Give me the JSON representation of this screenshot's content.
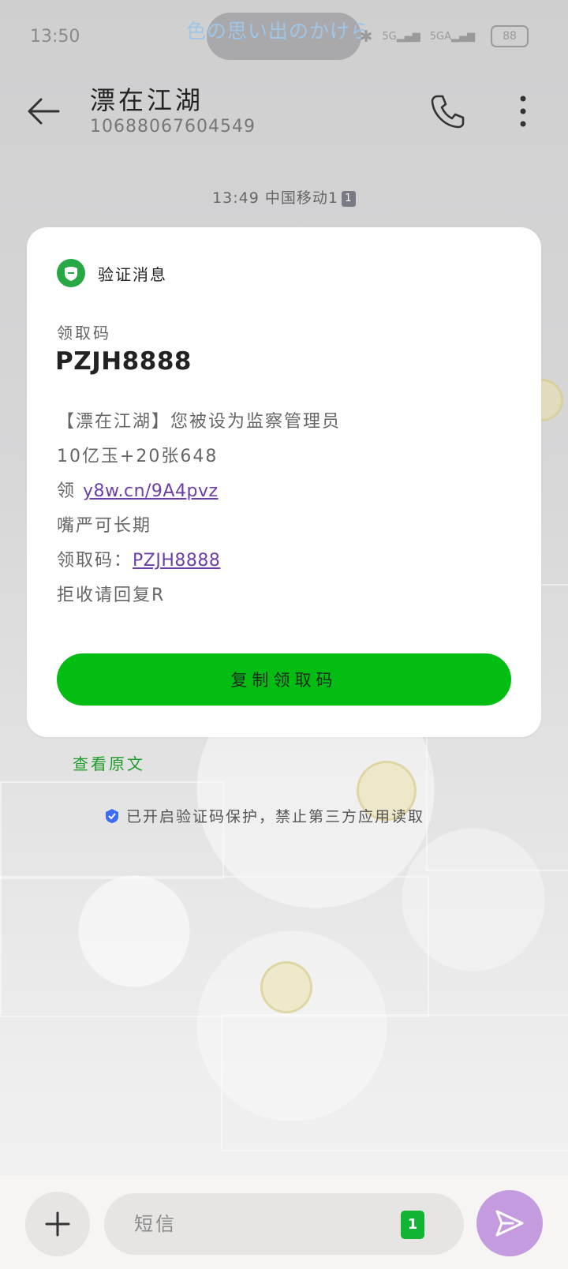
{
  "status_bar": {
    "time": "13:50",
    "ticker": "色の思い出のかけら",
    "bluetooth": "✱",
    "signal_1": "5G",
    "signal_2": "5GA",
    "battery": "88"
  },
  "header": {
    "contact_name": "漂在江湖",
    "contact_number": "10688067604549"
  },
  "conversation": {
    "timestamp": "13:49 中国移动1",
    "sim_badge": "1"
  },
  "card": {
    "title": "验证消息",
    "code_label": "领取码",
    "code_value": "PZJH8888",
    "lines": [
      "【漂在江湖】您被设为监察管理员",
      "10亿玉+20张648",
      "领 ",
      "嘴严可长期",
      "领取码：",
      "拒收请回复R"
    ],
    "link_url": "y8w.cn/9A4pvz",
    "link_code": "PZJH8888",
    "copy_button": "复制领取码"
  },
  "view_original": "查看原文",
  "protection_note": "已开启验证码保护，禁止第三方应用读取",
  "composer": {
    "placeholder": "短信",
    "sim_indicator": "1"
  },
  "colors": {
    "accent_green": "#03bd12",
    "link_purple": "#6b3fa6",
    "send_purple": "#c59be0"
  },
  "icons": [
    "back-arrow-icon",
    "phone-icon",
    "more-vertical-icon",
    "shield-icon",
    "protect-icon",
    "plus-icon",
    "send-icon",
    "bluetooth-icon",
    "signal-icon",
    "battery-icon"
  ]
}
